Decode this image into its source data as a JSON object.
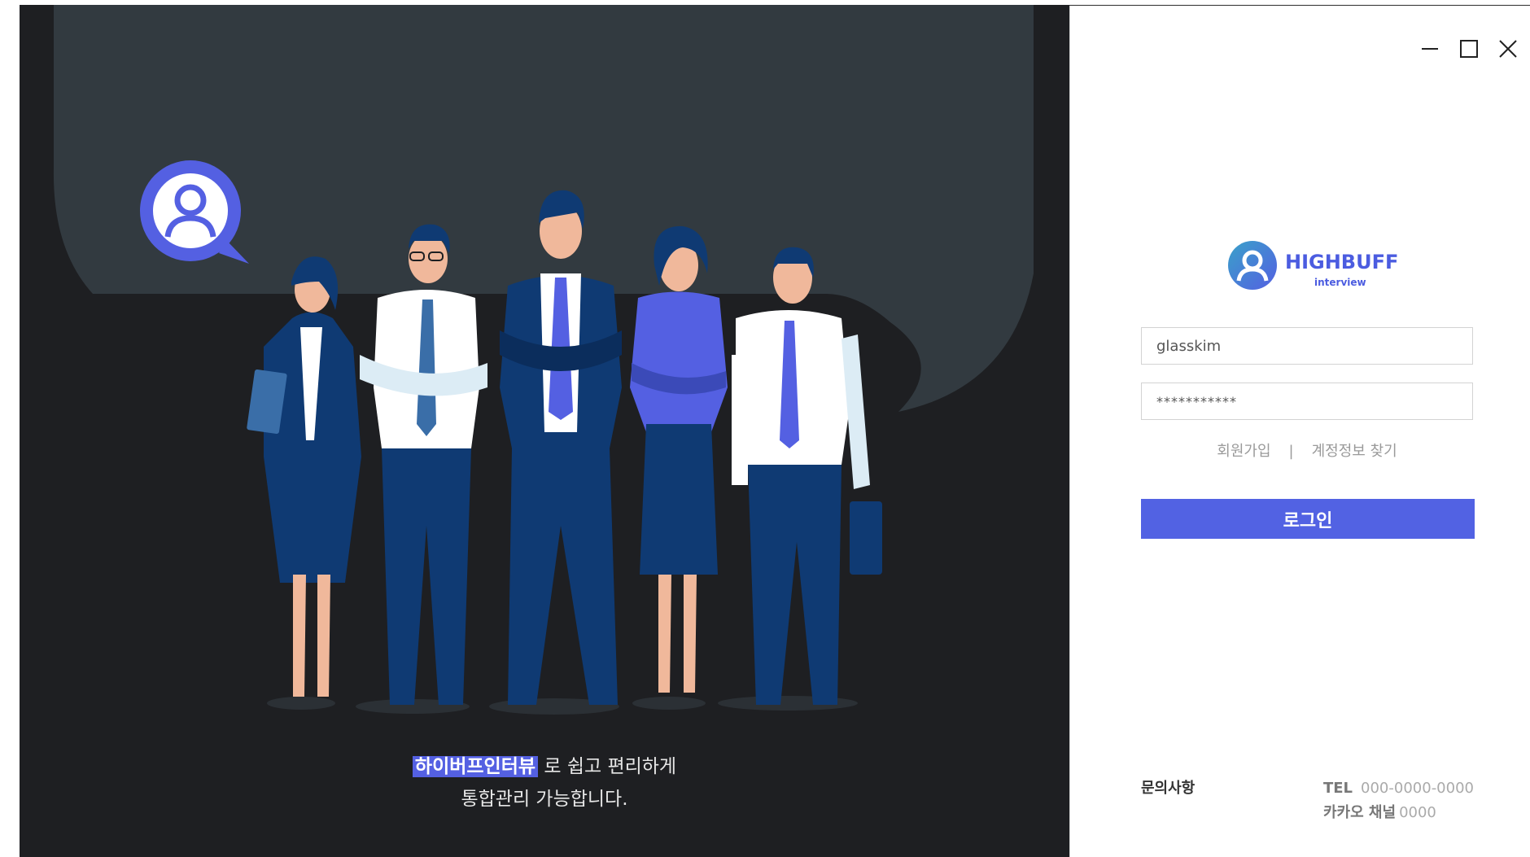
{
  "caption": {
    "highlight": "하이버프인터뷰",
    "line1_rest": " 로 쉽고 편리하게",
    "line2": "통합관리 가능합니다."
  },
  "window": {
    "minimize_icon": "minimize-icon",
    "maximize_icon": "maximize-icon",
    "close_icon": "close-icon"
  },
  "brand": {
    "name": "HIGHBUFF",
    "sub": "interview",
    "logo_icon": "user-avatar-icon",
    "colors": {
      "accent": "#5262e3",
      "dark_bg": "#1e1f22",
      "bubble": "#323a40"
    }
  },
  "login": {
    "username_value": "glasskim",
    "password_value": "***********",
    "signup_label": "회원가입",
    "separator": "|",
    "find_account_label": "계정정보 찾기",
    "login_button": "로그인"
  },
  "footer": {
    "inquiry_label": "문의사항",
    "tel_label": "TEL",
    "tel_value": "000-0000-0000",
    "kakao_label": "카카오 채널",
    "kakao_value": "0000"
  }
}
